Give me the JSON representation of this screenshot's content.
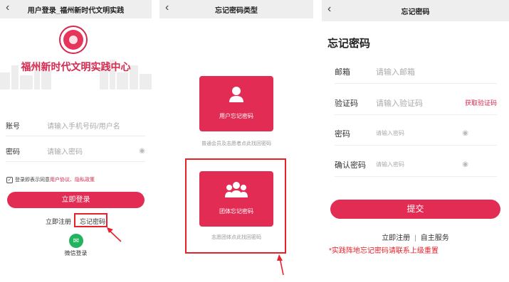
{
  "login": {
    "title": "用户登录_福州新时代文明实践",
    "brand": "福州新时代文明实践中心",
    "account_label": "账号",
    "account_placeholder": "请输入手机号码/用户名",
    "password_label": "密码",
    "password_placeholder": "请输入密码",
    "agree_prefix": "登录即表示同意",
    "agree_links": "用户协议、隐私政策",
    "login_button": "立即登录",
    "register_link": "立即注册",
    "forgot_link": "忘记密码",
    "wechat_label": "微信登录"
  },
  "type_select": {
    "title": "忘记密码类型",
    "user_card_label": "用户忘记密码",
    "user_card_caption": "普通会员及志愿者点此找回密码",
    "group_card_label": "团体忘记密码",
    "group_card_caption": "志愿团体点此找回密码"
  },
  "forgot": {
    "title": "忘记密码",
    "heading": "忘记密码",
    "email_label": "邮箱",
    "email_placeholder": "请输入邮箱",
    "code_label": "验证码",
    "code_placeholder": "请输入验证码",
    "get_code": "获取验证码",
    "password_label": "密码",
    "password_placeholder": "请输入密码",
    "confirm_label": "确认密码",
    "confirm_placeholder": "请输入密码",
    "submit_button": "提交",
    "register_link": "立即注册",
    "separator": "|",
    "self_service_link": "自主服务",
    "note": "*实践阵地忘记密码请联系上级重置"
  },
  "icons": {
    "back": "chevron-left-icon",
    "eye": "eye-icon",
    "checkbox": "checkbox-checked-icon",
    "wechat": "wechat-icon",
    "user": "user-icon",
    "group": "group-icon",
    "arrow": "pointer-arrow-icon"
  },
  "colors": {
    "brand_red": "#e22c54",
    "highlight_red": "#e8202a"
  }
}
